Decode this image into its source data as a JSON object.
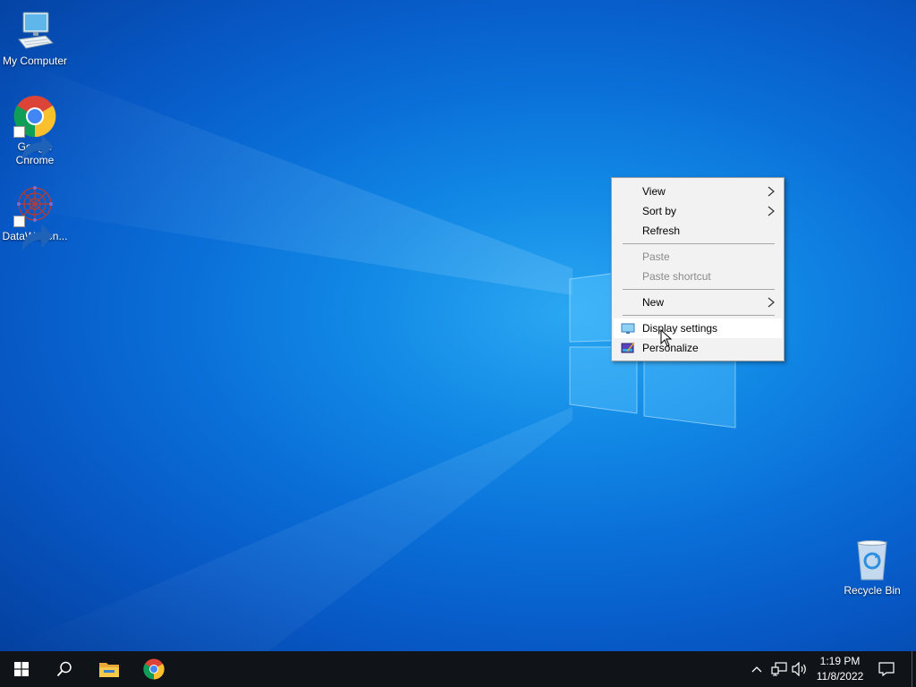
{
  "desktop_icons": [
    {
      "label": "My Computer",
      "icon": "computer-icon",
      "shortcut": false
    },
    {
      "label": "Google\nChrome",
      "icon": "chrome-icon",
      "shortcut": true
    },
    {
      "label": "DataWagon...",
      "icon": "datawagon-icon",
      "shortcut": true
    },
    {
      "label": "Recycle Bin",
      "icon": "recycle-bin-icon",
      "shortcut": false
    }
  ],
  "context_menu": {
    "items": [
      {
        "label": "View",
        "submenu": true,
        "enabled": true
      },
      {
        "label": "Sort by",
        "submenu": true,
        "enabled": true
      },
      {
        "label": "Refresh",
        "submenu": false,
        "enabled": true
      },
      {
        "label": "Paste",
        "submenu": false,
        "enabled": false
      },
      {
        "label": "Paste shortcut",
        "submenu": false,
        "enabled": false
      },
      {
        "label": "New",
        "submenu": true,
        "enabled": true
      },
      {
        "label": "Display settings",
        "submenu": false,
        "enabled": true,
        "icon": "display-icon",
        "highlighted": true
      },
      {
        "label": "Personalize",
        "submenu": false,
        "enabled": true,
        "icon": "personalize-icon"
      }
    ]
  },
  "taskbar": {
    "buttons": [
      "start-icon",
      "search-icon",
      "file-explorer-icon",
      "chrome-icon"
    ],
    "tray": [
      "chevron-up-icon",
      "network-icon",
      "volume-icon"
    ],
    "clock": {
      "time": "1:19 PM",
      "date": "11/8/2022"
    },
    "notification_icon": "action-center-icon"
  },
  "colors": {
    "desktop_blue": "#0a6fd8",
    "taskbar": "#101418",
    "menu_bg": "#f2f2f2"
  }
}
